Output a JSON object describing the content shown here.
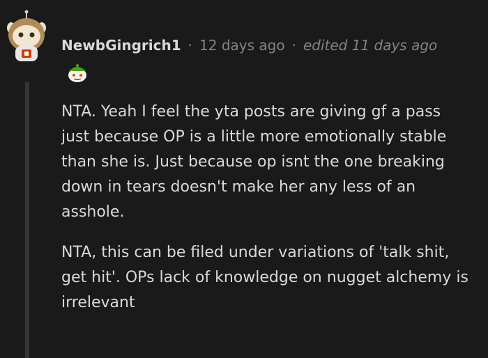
{
  "comment": {
    "username": "NewbGingrich1",
    "separator": "·",
    "age": "12 days ago",
    "edited": "edited 11 days ago",
    "paragraphs": [
      "NTA. Yeah I feel the yta posts are giving gf a pass just because OP is a little more emotionally stable than she is. Just because op isnt the one breaking down in tears doesn't make her any less of an asshole.",
      "NTA, this can be filed under variations of 'talk shit, get hit'. OPs lack of knowledge on nugget alchemy is irrelevant"
    ],
    "avatar_icon": "snoo-avatar-icon",
    "award_icon": "snoo-award-icon"
  },
  "colors": {
    "background": "#1a1a1b",
    "text": "#d7dadc",
    "meta": "#818384",
    "thread_line": "#343536"
  }
}
